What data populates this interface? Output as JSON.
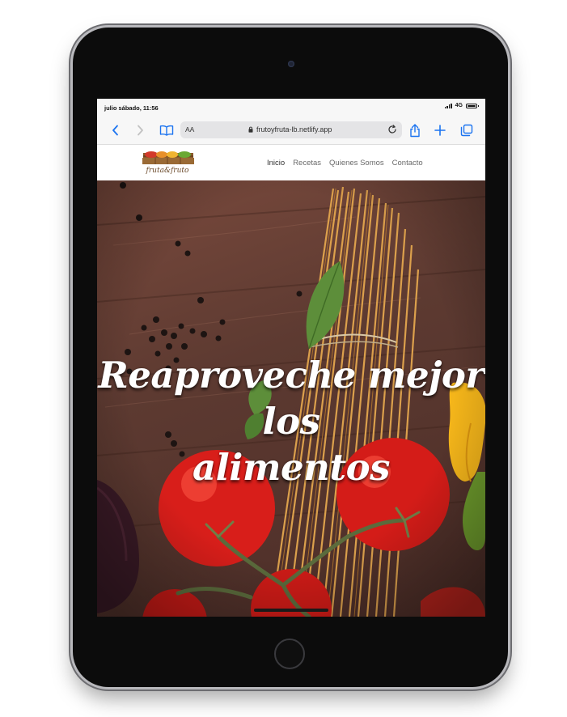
{
  "status_bar": {
    "time": "julio sábado, 11:56",
    "network": "4G"
  },
  "browser": {
    "text_size_label": "AA",
    "url": "frutoyfruta-lb.netlify.app",
    "icons": {
      "back": "chevron-left-icon",
      "forward": "chevron-right-icon",
      "bookmarks": "book-icon",
      "lock": "lock-icon",
      "reload": "reload-icon",
      "share": "share-icon",
      "new_tab": "plus-icon",
      "tabs": "tabs-icon"
    },
    "accent_color": "#1c74f0"
  },
  "site": {
    "logo_text": "fruta&fruto",
    "nav": [
      {
        "label": "Inicio",
        "active": true
      },
      {
        "label": "Recetas",
        "active": false
      },
      {
        "label": "Quienes Somos",
        "active": false
      },
      {
        "label": "Contacto",
        "active": false
      }
    ]
  },
  "hero": {
    "title_line1": "Reaproveche mejor los",
    "title_line2": "alimentos"
  }
}
